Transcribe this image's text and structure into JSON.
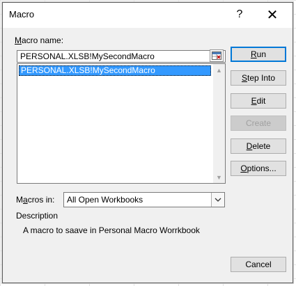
{
  "window": {
    "title": "Macro",
    "help_label": "?",
    "close_label": "✕"
  },
  "macro_name": {
    "label_prefix": "",
    "label_accel": "M",
    "label_rest": "acro name:",
    "value": "PERSONAL.XLSB!MySecondMacro"
  },
  "macro_list": {
    "items": [
      "PERSONAL.XLSB!MySecondMacro"
    ],
    "selected_index": 0
  },
  "buttons": {
    "run": {
      "accel": "R",
      "rest": "un"
    },
    "step_into": {
      "accel": "S",
      "rest": "tep Into"
    },
    "edit": {
      "accel": "E",
      "rest": "dit"
    },
    "create": {
      "label": "Create"
    },
    "delete": {
      "accel": "D",
      "rest": "elete"
    },
    "options": {
      "accel": "O",
      "rest": "ptions..."
    },
    "cancel": {
      "label": "Cancel"
    }
  },
  "macros_in": {
    "label_prefix": "M",
    "label_accel": "a",
    "label_rest": "cros in:",
    "value": "All Open Workbooks"
  },
  "description": {
    "label": "Description",
    "text": "A macro to saave in Personal Macro Worrkbook"
  },
  "colors": {
    "selection": "#3399ff",
    "default_button_border": "#0078d7",
    "dialog_bg": "#f0f0f0"
  }
}
